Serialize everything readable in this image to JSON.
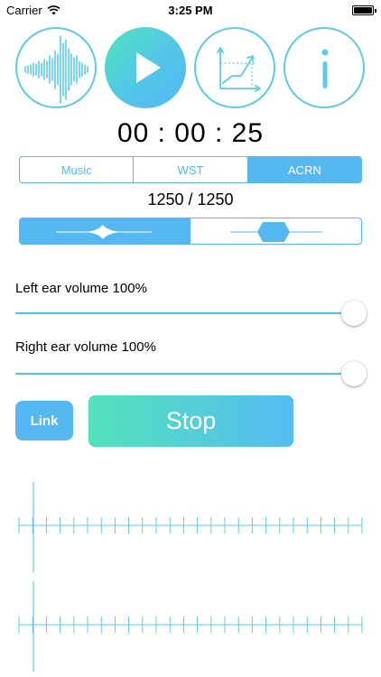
{
  "status_bar": {
    "carrier": "Carrier",
    "time": "3:25 PM"
  },
  "toolbar": {
    "buttons": [
      {
        "icon": "waveform-icon"
      },
      {
        "icon": "play-icon"
      },
      {
        "icon": "chart-icon"
      },
      {
        "icon": "info-icon"
      }
    ]
  },
  "timer": "00 : 00 : 25",
  "mode_tabs": {
    "items": [
      "Music",
      "WST",
      "ACRN"
    ],
    "selected": "ACRN"
  },
  "count": "1250 / 1250",
  "waveform_selector": {
    "options": [
      "sharp-waveform-icon",
      "hexagon-waveform-icon"
    ],
    "selected_index": 0
  },
  "left_volume": {
    "label": "Left ear volume 100%",
    "value": 1.0
  },
  "right_volume": {
    "label": "Right ear volume 100%",
    "value": 1.0
  },
  "link_button": "Link",
  "stop_button": "Stop",
  "colors": {
    "accent_blue": "#55b8f0",
    "gradient_green": "#53e2b9",
    "gradient_blue": "#55bdf3",
    "icon_teal": "#5ecbe6"
  },
  "scales": {
    "tick_count": 26
  }
}
